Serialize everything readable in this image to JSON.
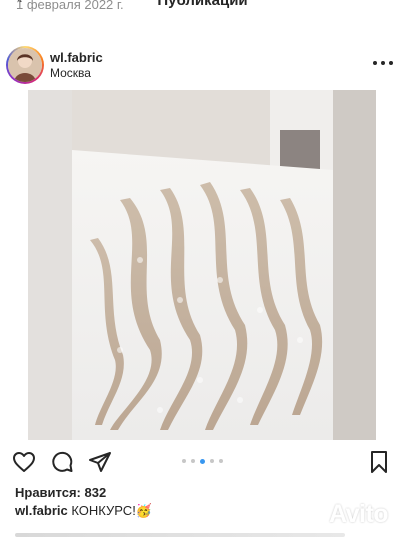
{
  "top": {
    "date": "1 февраля 2022 г.",
    "title": "Публикации"
  },
  "post": {
    "username": "wl.fabric",
    "location": "Москва",
    "more_icon": "more-horizontal-icon"
  },
  "photo": {
    "subject": "embroidered sequin fabric",
    "carousel": {
      "count": 5,
      "active_index": 2
    }
  },
  "actions": {
    "like_icon": "heart-icon",
    "comment_icon": "comment-icon",
    "share_icon": "send-icon",
    "save_icon": "bookmark-icon"
  },
  "likes_label": "Нравится: 832",
  "caption": {
    "username": "wl.fabric",
    "text": "КОНКУРС!",
    "emoji": "🥳"
  },
  "watermark": {
    "text": "Avito"
  }
}
